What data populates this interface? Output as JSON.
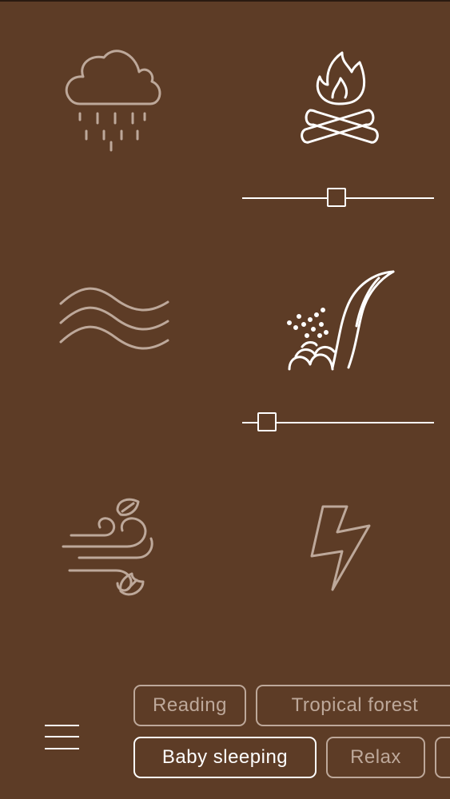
{
  "colors": {
    "background": "#5d3c26",
    "inactive_icon": "#bda89a",
    "active_icon": "#ffffff"
  },
  "sounds": [
    {
      "name": "rain-icon",
      "active": false
    },
    {
      "name": "campfire-icon",
      "active": true,
      "volume": 0.49
    },
    {
      "name": "waves-icon",
      "active": false
    },
    {
      "name": "waterfall-icon",
      "active": true,
      "volume": 0.13
    },
    {
      "name": "wind-icon",
      "active": false
    },
    {
      "name": "thunder-icon",
      "active": false
    }
  ],
  "presets": {
    "row1": [
      "Reading",
      "Tropical forest"
    ],
    "row2": [
      "Baby sleeping",
      "Relax"
    ],
    "selected": "Baby sleeping"
  },
  "menu": {
    "icon": "hamburger-menu-icon"
  }
}
